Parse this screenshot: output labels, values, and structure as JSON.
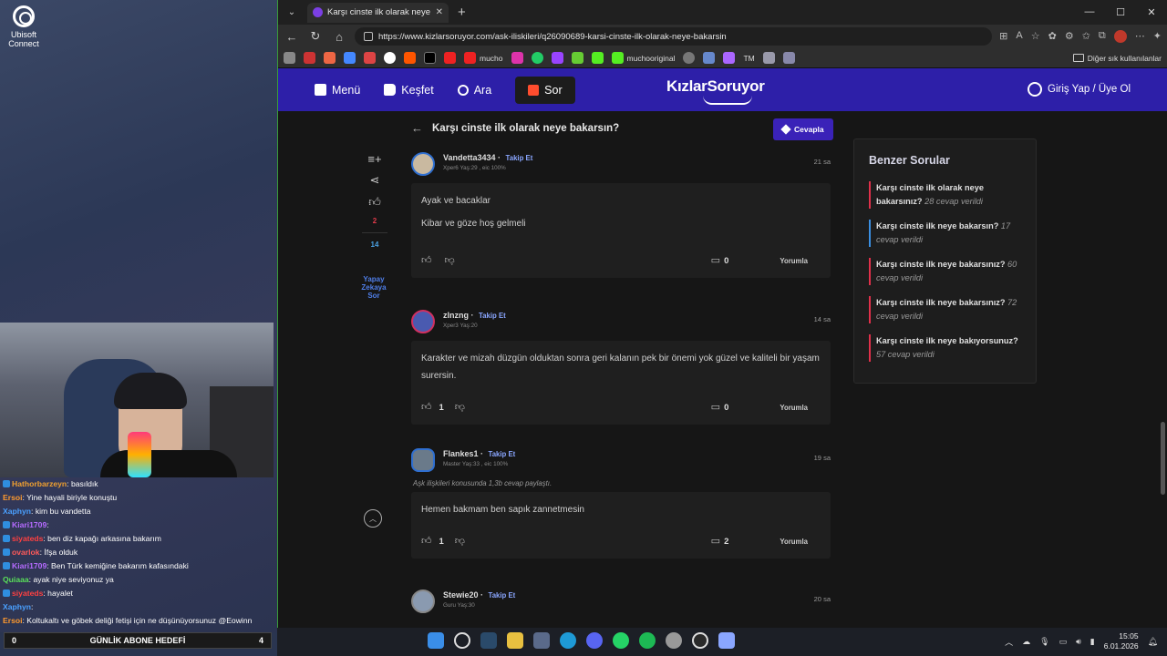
{
  "desktop": {
    "icon_label": "Ubisoft Connect"
  },
  "chat": [
    {
      "user": "Hathorbarzeyn",
      "user_color": "#f0a030",
      "msg": ": basıldık"
    },
    {
      "user": "Ersoi",
      "user_color": "#ff9a2e",
      "msg": ": Yine hayali biriyle konuştu"
    },
    {
      "user": "Xaphyn",
      "user_color": "#4aa0ff",
      "msg": ": kim bu vandetta"
    },
    {
      "user": "Kiari1709",
      "user_color": "#b56bff",
      "msg": ":"
    },
    {
      "user": "siyateds",
      "user_color": "#ff4040",
      "msg": ": ben diz kapağı arkasına bakarım"
    },
    {
      "user": "ovarlok",
      "user_color": "#ff5a5a",
      "msg": ": İfşa olduk"
    },
    {
      "user": "Kiari1709",
      "user_color": "#b56bff",
      "msg": ": Ben Türk kemiğine bakarım kafasındaki"
    },
    {
      "user": "Quiaaa",
      "user_color": "#5ae05a",
      "msg": ": ayak niye seviyonuz ya"
    },
    {
      "user": "siyateds",
      "user_color": "#ff4040",
      "msg": ": hayalet"
    },
    {
      "user": "Xaphyn",
      "user_color": "#4aa0ff",
      "msg": ":"
    },
    {
      "user": "Ersoi",
      "user_color": "#ff9a2e",
      "msg": ": Koltukaltı ve göbek deliği fetişi için ne düşünüyorsunuz @Eowinn"
    }
  ],
  "goal": {
    "left": "0",
    "label": "GÜNLİK ABONE HEDEFİ",
    "right": "4"
  },
  "browser": {
    "tab_title": "Karşı cinste ilk olarak neye bakarsın",
    "url": "https://www.kizlarsoruyor.com/ask-iliskileri/q26090689-karsi-cinste-ilk-olarak-neye-bakarsin",
    "bookmarks": [
      "mucho",
      "muchooriginal",
      "TM"
    ],
    "other_bookmarks": "Diğer sık kullanılanlar"
  },
  "site": {
    "nav": {
      "menu": "Menü",
      "discover": "Keşfet",
      "search": "Ara",
      "ask": "Sor"
    },
    "logo": "KızlarSoruyor",
    "login": "Giriş Yap / Üye Ol",
    "question_title": "Karşı cinste ilk olarak neye bakarsın?",
    "answer_button": "Cevapla",
    "side_counts": {
      "likes": "2",
      "comments": "14"
    },
    "ai_ask": "Yapay Zekaya Sor",
    "reply_label": "Yorumla",
    "answers": [
      {
        "user": "Vandetta3434",
        "follow": "Takip Et",
        "meta": "Xper6 Yaş:29 , eic 100%",
        "time": "21 sa",
        "note": "",
        "paragraphs": [
          "Ayak ve bacaklar",
          "Kibar ve göze hoş gelmeli"
        ],
        "likes": "",
        "comments": "0"
      },
      {
        "user": "zlnzng",
        "follow": "Takip Et",
        "meta": "Xper3 Yaş:20",
        "time": "14 sa",
        "note": "",
        "paragraphs": [
          "Karakter ve mizah düzgün olduktan sonra geri kalanın pek bir önemi yok güzel ve kaliteli bir yaşam surersin."
        ],
        "likes": "1",
        "comments": "0"
      },
      {
        "user": "Flankes1",
        "follow": "Takip Et",
        "meta": "Master Yaş:33 , eic 100%",
        "time": "19 sa",
        "note": "Aşk ilişkileri konusunda 1,3b cevap paylaştı.",
        "paragraphs": [
          "Hemen bakmam ben sapık zannetmesin"
        ],
        "likes": "1",
        "comments": "2"
      },
      {
        "user": "Stewie20",
        "follow": "Takip Et",
        "meta": "Guru Yaş:30",
        "time": "20 sa",
        "note": "",
        "paragraphs": [],
        "likes": "",
        "comments": ""
      }
    ],
    "similar": {
      "title": "Benzer Sorular",
      "items": [
        {
          "q": "Karşı cinste ilk olarak neye bakarsınız?",
          "a": "28 cevap verildi"
        },
        {
          "q": "Karşı cinste ilk neye bakarsın?",
          "a": "17 cevap verildi"
        },
        {
          "q": "Karşı cinste ilk neye bakarsınız?",
          "a": "60 cevap verildi"
        },
        {
          "q": "Karşı cinste ilk neye bakarsınız?",
          "a": "72 cevap verildi"
        },
        {
          "q": "Karşı cinste ilk neye bakıyorsunuz?",
          "a": "57 cevap verildi"
        }
      ]
    }
  },
  "taskbar": {
    "time": "15:05",
    "date": "6.01.2026"
  },
  "colors": {
    "site_header": "#2d1fa8",
    "accent_button": "#3a22b8",
    "sor_plus": "#ff4d2e"
  }
}
